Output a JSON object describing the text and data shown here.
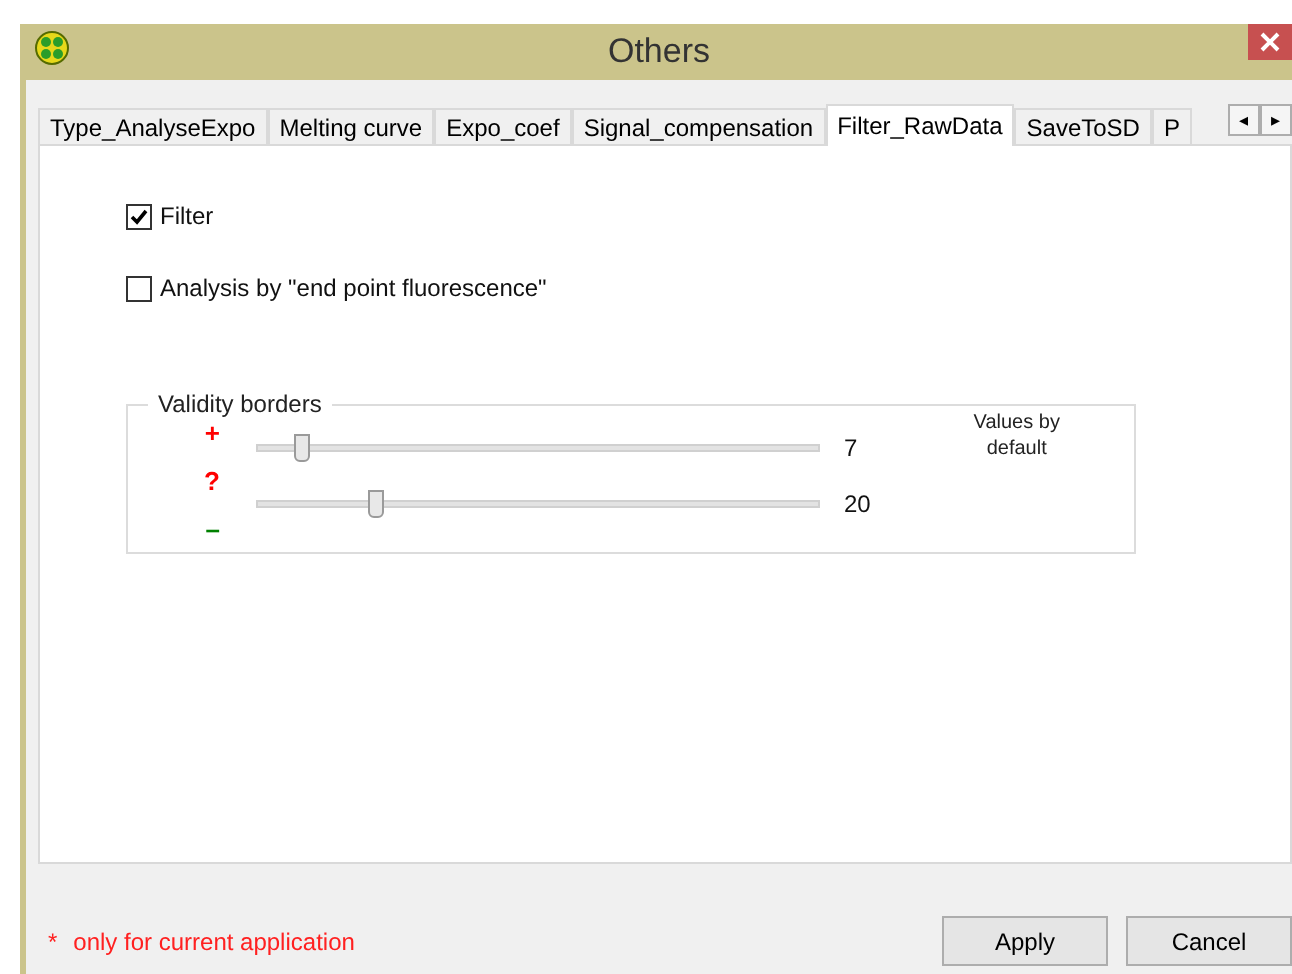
{
  "window": {
    "title": "Others"
  },
  "tabs": [
    {
      "label": "Type_AnalyseExpo",
      "selected": false
    },
    {
      "label": "Melting curve",
      "selected": false
    },
    {
      "label": "Expo_coef",
      "selected": false
    },
    {
      "label": "Signal_compensation",
      "selected": false
    },
    {
      "label": "Filter_RawData",
      "selected": true
    },
    {
      "label": "SaveToSD",
      "selected": false
    },
    {
      "label": "P",
      "selected": false
    }
  ],
  "tab_scroll": [
    "◂",
    "▸"
  ],
  "options": [
    {
      "label": "Filter",
      "checked": true
    },
    {
      "label": "Analysis by \"end point fluorescence\"",
      "checked": false
    }
  ],
  "validity_borders": {
    "title": "Validity borders",
    "markers": [
      {
        "text": "+",
        "color": "#ff0000"
      },
      {
        "text": "?",
        "color": "#ff0000"
      },
      {
        "text": "–",
        "color": "#008000"
      }
    ],
    "sliders": [
      {
        "level": 0.08,
        "reading": "7"
      },
      {
        "level": 0.21,
        "reading": "20"
      }
    ],
    "defaults_label": "Values by default"
  },
  "footnote": {
    "mark": "*",
    "text": "only for current application"
  },
  "buttons": [
    "Apply",
    "Cancel"
  ]
}
